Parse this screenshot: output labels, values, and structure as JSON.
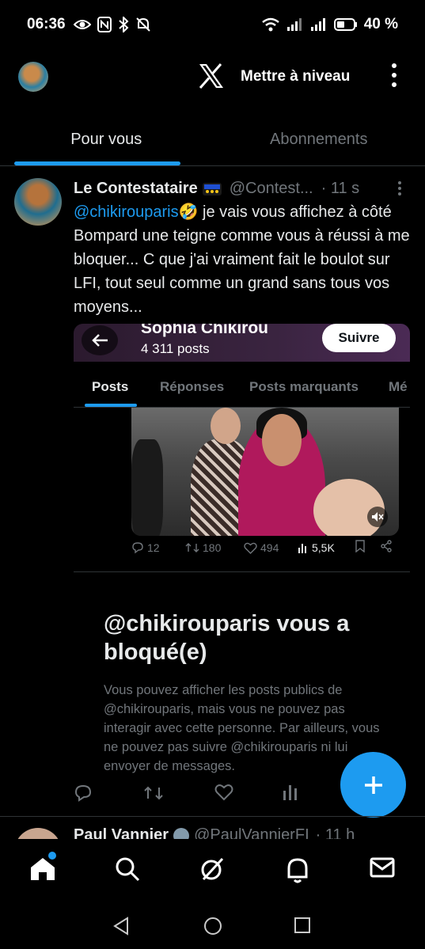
{
  "status_bar": {
    "time": "06:36",
    "battery": "40 %"
  },
  "app_bar": {
    "upgrade_label": "Mettre à niveau"
  },
  "tabs": [
    {
      "label": "Pour vous",
      "active": true
    },
    {
      "label": "Abonnements",
      "active": false
    }
  ],
  "post": {
    "author_name": "Le Contestataire",
    "handle": "@Contest...",
    "time": "· 11 s",
    "mention": "@chikirouparis",
    "emoji": "🤣",
    "text": " je vais vous affichez à côté Bompard une teigne comme vous à réussi à me bloquer... C que j'ai vraiment fait le boulot sur LFI, tout seul comme un grand sans tous vos moyens..."
  },
  "embedded": {
    "profile_name": "Sophia Chikirou",
    "post_count": "4 311 posts",
    "follow_label": "Suivre",
    "tabs": [
      "Posts",
      "Réponses",
      "Posts marquants",
      "Mé"
    ],
    "actions": {
      "replies": "12",
      "reposts": "180",
      "likes": "494",
      "views": "5,5K"
    }
  },
  "blocked": {
    "title": "@chikirouparis vous a bloqué(e)",
    "description": "Vous pouvez afficher les posts publics de @chikirouparis, mais vous ne pouvez pas interagir avec cette personne. Par ailleurs, vous ne pouvez pas suivre @chikirouparis ni lui envoyer de messages."
  },
  "next_post": {
    "author_name": "Paul Vannier",
    "handle": "@PaulVannierFI",
    "time": "· 11 h"
  },
  "colors": {
    "accent": "#1d9bf0",
    "muted": "#71767b",
    "text": "#e7e9ea",
    "background": "#000000"
  },
  "icons": {
    "status_left": [
      "eye-icon",
      "nfc-icon",
      "bluetooth-icon",
      "mute-icon"
    ],
    "status_right": [
      "wifi-icon",
      "signal-icon",
      "signal-icon",
      "battery-icon"
    ],
    "bottom_nav": [
      "home-icon",
      "search-icon",
      "grok-icon",
      "bell-icon",
      "mail-icon"
    ],
    "system_nav": [
      "back-icon",
      "home-circle-icon",
      "recents-icon"
    ]
  }
}
